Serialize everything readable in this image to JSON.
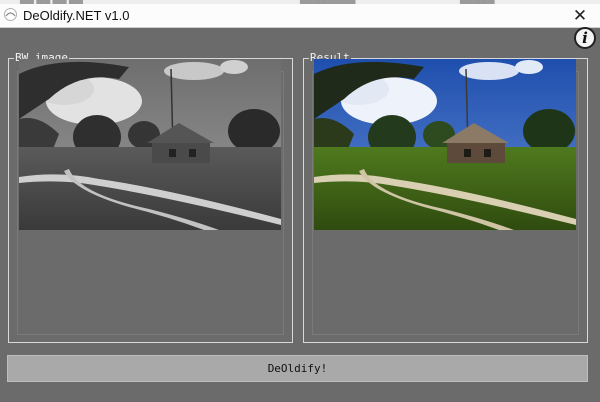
{
  "window": {
    "title": "DeOldify.NET v1.0",
    "close_glyph": "✕",
    "app_icon": "deoldify-app-icon"
  },
  "toolbar": {
    "info_glyph": "i",
    "info_icon": "info-icon"
  },
  "panels": {
    "bw": {
      "label": "BW image",
      "image": "grayscale photo of a rural house with trees and a dirt road"
    },
    "result": {
      "label": "Result",
      "image": "colorized photo of a rural house with blue sky, green grass and a dirt road"
    }
  },
  "actions": {
    "deoldify_label": "DeOldify!"
  },
  "colors": {
    "client_bg": "#6b6b6b",
    "titlebar_bg": "#fcfcfc",
    "button_bg": "#a9a9a9",
    "group_border": "#d8d8d8"
  }
}
